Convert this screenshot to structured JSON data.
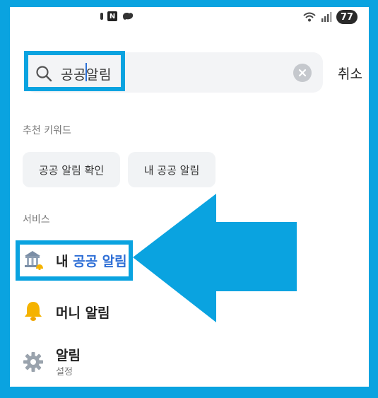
{
  "status_bar": {
    "n_badge": "N",
    "battery": "77"
  },
  "search": {
    "query": "공공알림",
    "cancel_label": "취소"
  },
  "recommended": {
    "section_label": "추천 키워드",
    "keywords": [
      "공공 알림 확인",
      "내 공공 알림"
    ]
  },
  "services": {
    "section_label": "서비스",
    "items": [
      {
        "prefix": "내 ",
        "highlight": "공공 알림",
        "icon": "public-building-bell-icon"
      },
      {
        "title": "머니 알림",
        "icon": "bell-icon"
      },
      {
        "title": "알림",
        "subtitle": "설정",
        "icon": "gear-icon"
      }
    ]
  },
  "colors": {
    "frame": "#0aa3e0",
    "accent_text": "#2f6fd6",
    "search_bg": "#f3f4f6"
  }
}
